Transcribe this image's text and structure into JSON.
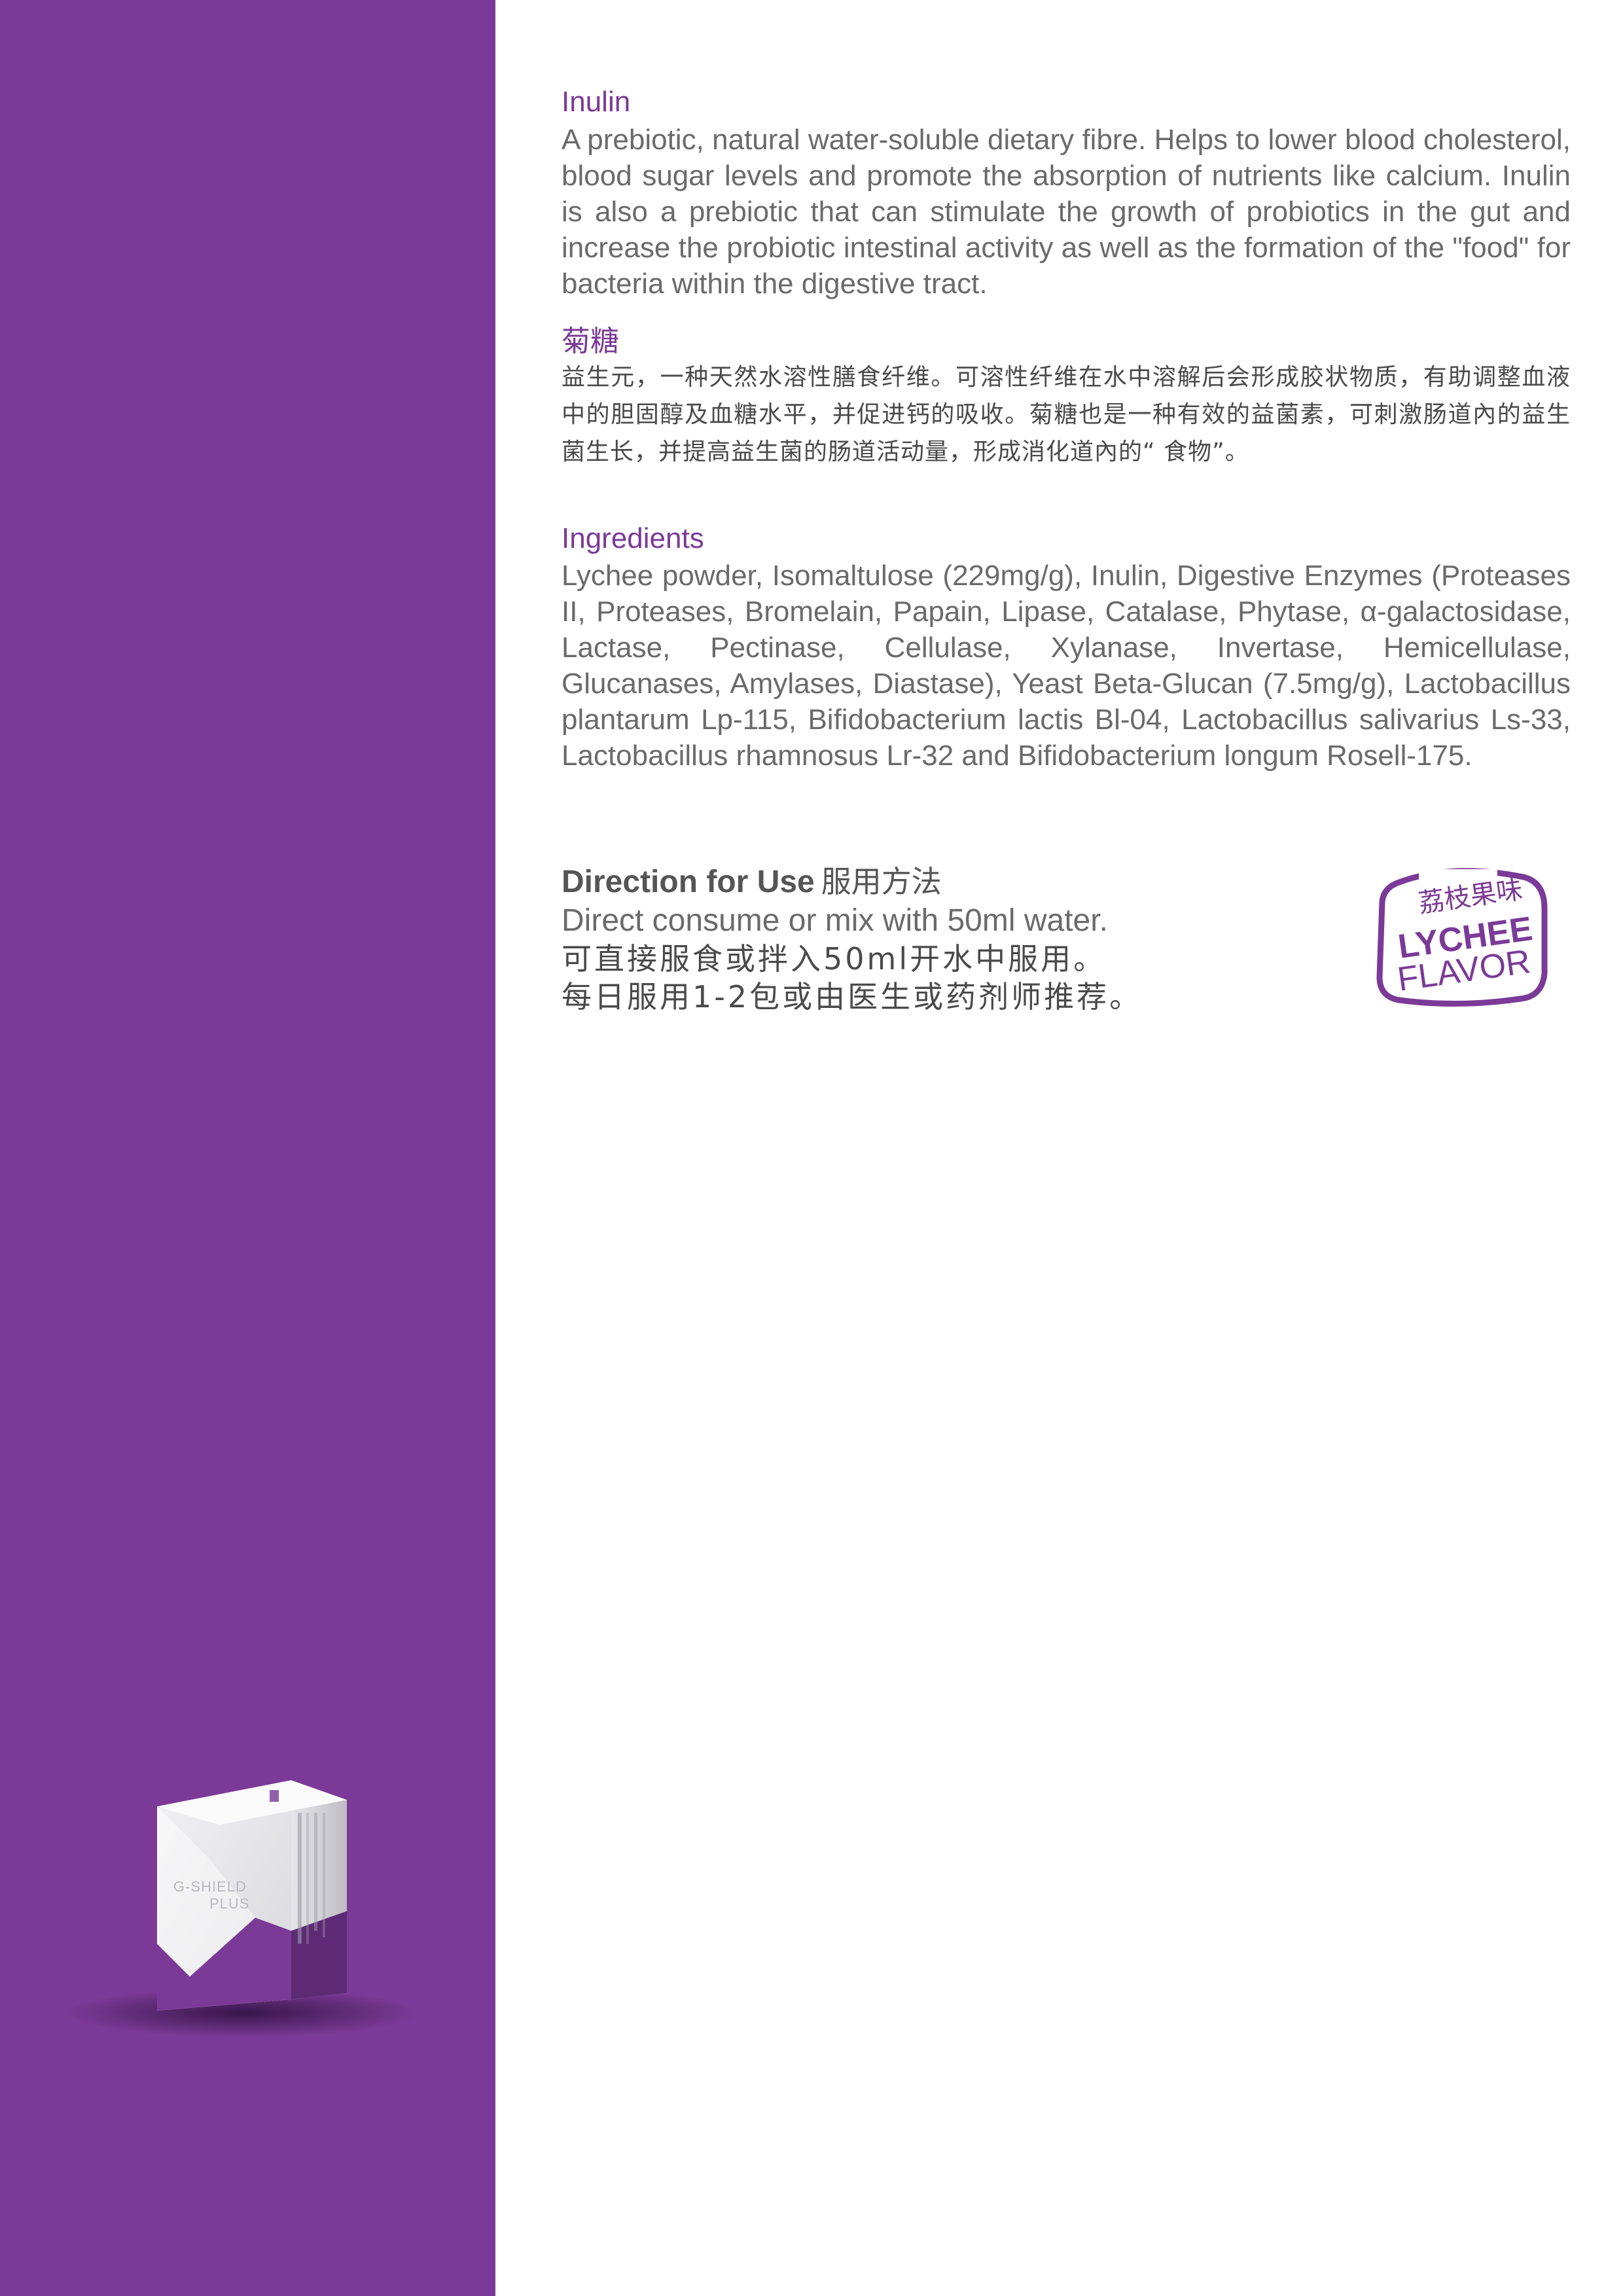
{
  "inulin": {
    "title": "Inulin",
    "text": "A prebiotic, natural water-soluble dietary fibre. Helps to lower blood cholesterol, blood sugar levels and promote the absorption of nutrients like calcium. Inulin is also a prebiotic that can stimulate the growth of probiotics in the gut and increase the probiotic intestinal activity as well as the formation of the \"food\" for bacteria within the digestive tract."
  },
  "inulin_cn": {
    "title": "菊糖",
    "text": "益生元，一种天然水溶性膳食纤维。可溶性纤维在水中溶解后会形成胶状物质，有助调整血液中的胆固醇及血糖水平，并促进钙的吸收。菊糖也是一种有效的益菌素，可刺激肠道內的益生菌生长，并提高益生菌的肠道活动量，形成消化道內的“ 食物”。"
  },
  "ingredients": {
    "title": "Ingredients",
    "text": "Lychee powder, Isomaltulose (229mg/g), Inulin, Digestive Enzymes (Proteases II, Proteases, Bromelain, Papain, Lipase, Catalase, Phytase, α-galactosidase, Lactase, Pectinase, Cellulase, Xylanase, Invertase, Hemicellulase, Glucanases, Amylases, Diastase), Yeast Beta-Glucan (7.5mg/g), Lactobacillus plantarum Lp-115, Bifidobacterium lactis Bl-04, Lactobacillus salivarius Ls-33, Lactobacillus rhamnosus Lr-32 and Bifidobacterium longum Rosell-175."
  },
  "direction": {
    "title_en": "Direction for Use",
    "title_cn": "服用方法",
    "line_en": "Direct consume or mix with 50ml water.",
    "line_cn1": "可直接服食或拌入50ml开水中服用。",
    "line_cn2": "每日服用1-2包或由医生或药剂师推荐。"
  },
  "badge": {
    "cn": "荔枝果味",
    "line1": "LYCHEE",
    "line2": "FLAVOR"
  },
  "product": {
    "brand_lines": [
      "G-SHIELD",
      "PLUS"
    ]
  },
  "colors": {
    "sidebar": "#7b3a97",
    "accent": "#7b3a97",
    "text": "#6a6a6a"
  }
}
